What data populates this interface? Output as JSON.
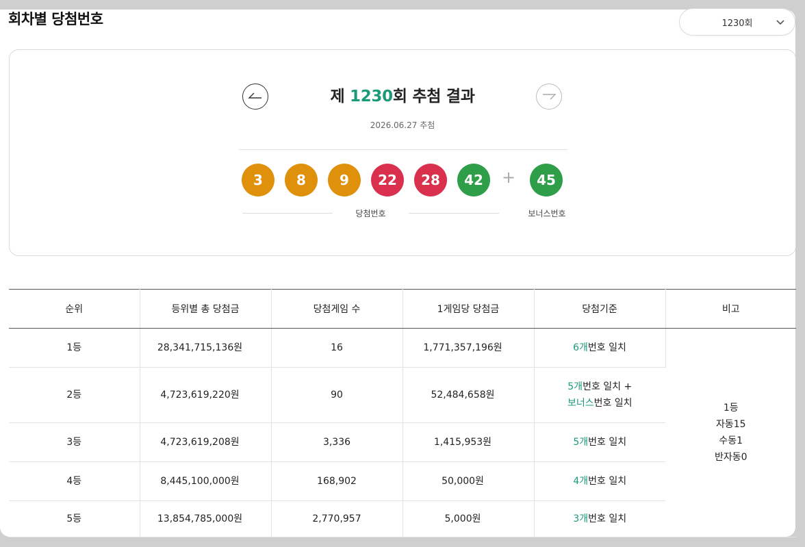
{
  "page_title": "회차별 당첨번호",
  "round_select": {
    "value": "1230회"
  },
  "draw": {
    "title_prefix": "제 ",
    "round": "1230",
    "title_suffix": "회 추첨 결과",
    "date": "2026.06.27 추첨",
    "numbers": [
      {
        "value": "3",
        "color": "#e0910c"
      },
      {
        "value": "8",
        "color": "#e0910c"
      },
      {
        "value": "9",
        "color": "#e0910c"
      },
      {
        "value": "22",
        "color": "#d9304e"
      },
      {
        "value": "28",
        "color": "#d9304e"
      },
      {
        "value": "42",
        "color": "#2f9e48"
      }
    ],
    "plus": "+",
    "bonus": {
      "value": "45",
      "color": "#2f9e48"
    },
    "numbers_label": "당첨번호",
    "bonus_label": "보너스번호"
  },
  "table": {
    "headers": [
      "순위",
      "등위별 총 당첨금",
      "당첨게임 수",
      "1게임당 당첨금",
      "당첨기준",
      "비고"
    ],
    "rows": [
      {
        "rank": "1등",
        "total": "28,341,715,136원",
        "games": "16",
        "per_game": "1,771,357,196원",
        "criteria_num": "6개",
        "criteria_text": "번호 일치"
      },
      {
        "rank": "2등",
        "total": "4,723,619,220원",
        "games": "90",
        "per_game": "52,484,658원",
        "criteria_num": "5개",
        "criteria_text": "번호 일치 +",
        "criteria_bonus": "보너스",
        "criteria_bonus_text": "번호 일치"
      },
      {
        "rank": "3등",
        "total": "4,723,619,208원",
        "games": "3,336",
        "per_game": "1,415,953원",
        "criteria_num": "5개",
        "criteria_text": "번호 일치"
      },
      {
        "rank": "4등",
        "total": "8,445,100,000원",
        "games": "168,902",
        "per_game": "50,000원",
        "criteria_num": "4개",
        "criteria_text": "번호 일치"
      },
      {
        "rank": "5등",
        "total": "13,854,785,000원",
        "games": "2,770,957",
        "per_game": "5,000원",
        "criteria_num": "3개",
        "criteria_text": "번호 일치"
      }
    ],
    "note": [
      "1등",
      "자동15",
      "수동1",
      "반자동0"
    ]
  },
  "colors": {
    "accent": "#1b9a7a",
    "yellow_ball": "#e0910c",
    "red_ball": "#d9304e",
    "green_ball": "#2f9e48"
  },
  "icons": {
    "prev": "arrow-left-icon",
    "next": "arrow-right-icon",
    "select": "chevron-down-icon"
  }
}
